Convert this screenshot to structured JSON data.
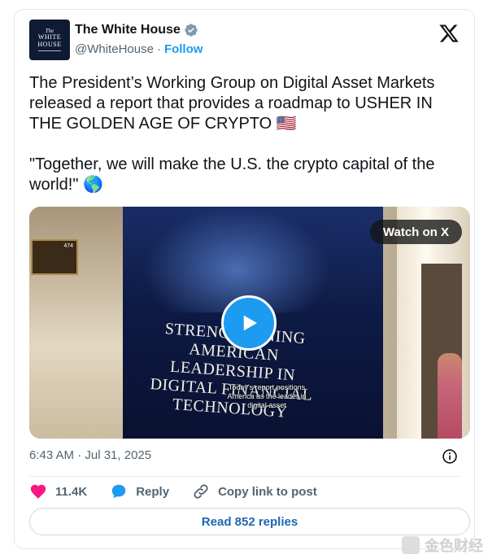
{
  "account": {
    "display_name": "The White House",
    "handle": "@WhiteHouse",
    "separator": "·",
    "follow_label": "Follow",
    "avatar_line1": "The",
    "avatar_line2": "WHITE",
    "avatar_line3": "HOUSE"
  },
  "tweet": {
    "paragraph1": "The President’s Working Group on Digital Asset Markets released a report that provides a roadmap to USHER IN THE GOLDEN AGE OF CRYPTO 🇺🇸",
    "paragraph2": "\"Together, we will make the U.S. the crypto capital of the world!\" 🌎"
  },
  "media": {
    "watch_label": "Watch on X",
    "poster_text": "STRENGTHENING AMERICAN LEADERSHIP IN DIGITAL FINANCIAL TECHNOLOGY",
    "caption": "Today's report positions America as the leader in digital asset",
    "plaque_number": "474",
    "play_icon": "play-icon"
  },
  "meta": {
    "timestamp": "6:43 AM · Jul 31, 2025"
  },
  "actions": {
    "likes_count": "11.4K",
    "reply_label": "Reply",
    "copy_link_label": "Copy link to post"
  },
  "replies": {
    "read_label": "Read 852 replies"
  },
  "watermark": {
    "text": "金色财经"
  },
  "colors": {
    "accent": "#1d9bf0",
    "like": "#f91880",
    "text": "#0f1419",
    "muted": "#536471"
  }
}
